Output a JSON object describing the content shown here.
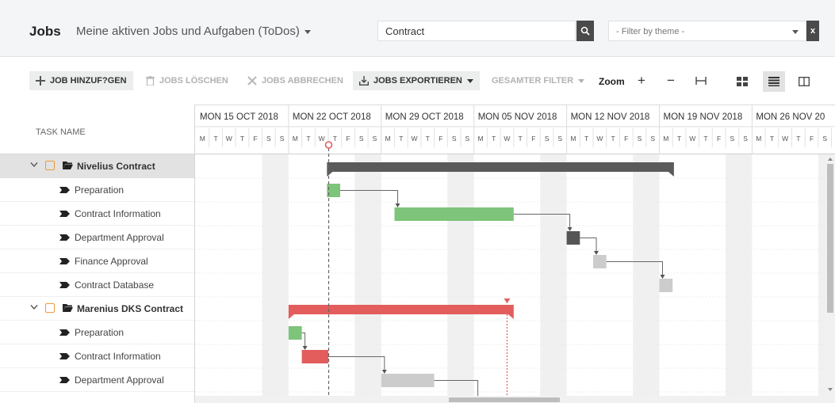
{
  "header": {
    "title": "Jobs",
    "subtitle": "Meine aktiven Jobs und Aufgaben (ToDos)",
    "search_value": "Contract",
    "filter_placeholder": "- Filter by theme -",
    "filter_clear_label": "x"
  },
  "toolbar": {
    "add_job": "JOB HINZUF?GEN",
    "delete_jobs": "JOBS LÖSCHEN",
    "cancel_jobs": "JOBS ABBRECHEN",
    "export_jobs": "JOBS EXPORTIEREN",
    "total_filter": "GESAMTER FILTER",
    "zoom_label": "Zoom",
    "zoom_in": "+",
    "zoom_out": "−",
    "fit": "⊢⊣"
  },
  "task_list": {
    "header": "TASK NAME",
    "groups": [
      {
        "name": "Nivelius Contract",
        "tasks": [
          "Preparation",
          "Contract Information",
          "Department Approval",
          "Finance Approval",
          "Contract Database"
        ]
      },
      {
        "name": "Marenius DKS Contract",
        "tasks": [
          "Preparation",
          "Contract Information",
          "Department Approval"
        ]
      }
    ]
  },
  "timeline": {
    "weeks": [
      "MON 15 OCT 2018",
      "MON 22 OCT 2018",
      "MON 29 OCT 2018",
      "MON 05 NOV 2018",
      "MON 12 NOV 2018",
      "MON 19 NOV 2018",
      "MON 26 NOV 20"
    ],
    "day_letters": [
      "M",
      "T",
      "W",
      "T",
      "F",
      "S",
      "S"
    ],
    "today_day_index": 10,
    "deadline_day_index": 23.5
  },
  "bars": [
    {
      "row": 0,
      "type": "summary",
      "start": 9.9,
      "end": 36.1,
      "color": "#5a5a5a"
    },
    {
      "row": 1,
      "type": "task",
      "start": 9.9,
      "end": 10.9,
      "color": "#7ec47a"
    },
    {
      "row": 2,
      "type": "task",
      "start": 15,
      "end": 24,
      "color": "#7ec47a"
    },
    {
      "row": 3,
      "type": "task",
      "start": 28,
      "end": 29,
      "color": "#555555"
    },
    {
      "row": 4,
      "type": "task",
      "start": 30,
      "end": 31,
      "color": "#cccccc"
    },
    {
      "row": 5,
      "type": "task",
      "start": 35,
      "end": 36,
      "color": "#cccccc"
    },
    {
      "row": 6,
      "type": "summary",
      "start": 7,
      "end": 24,
      "color": "#e35d5d"
    },
    {
      "row": 7,
      "type": "task",
      "start": 7,
      "end": 8,
      "color": "#7ec47a"
    },
    {
      "row": 8,
      "type": "task",
      "start": 8,
      "end": 10,
      "color": "#e35d5d"
    },
    {
      "row": 9,
      "type": "task",
      "start": 14,
      "end": 18,
      "color": "#cccccc"
    }
  ],
  "colors": {
    "accent_orange": "#f09a36",
    "summary_dark": "#5a5a5a",
    "task_green": "#7ec47a",
    "task_red": "#e35d5d",
    "task_grey": "#cccccc",
    "weekend_shade": "#f0f0f0"
  }
}
